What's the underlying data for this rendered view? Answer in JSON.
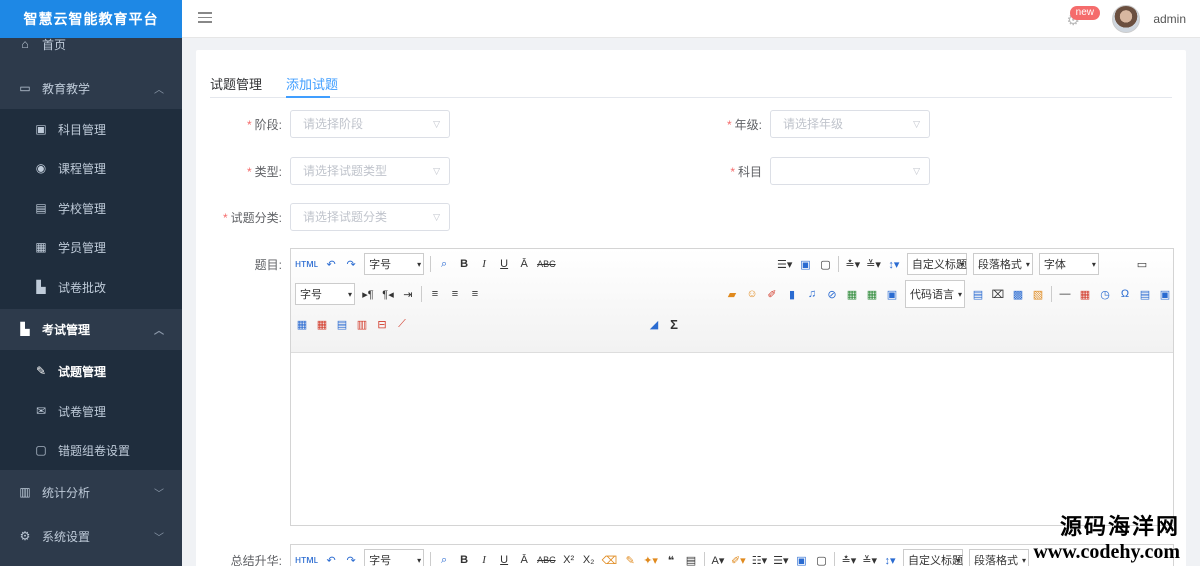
{
  "app": {
    "title": "智慧云智能教育平台"
  },
  "header": {
    "badge": "new",
    "user": "admin"
  },
  "sidebar": {
    "items": [
      {
        "label": "首页",
        "icon": "home-icon"
      },
      {
        "label": "教育教学",
        "icon": "video-icon"
      },
      {
        "label": "科目管理",
        "icon": "briefcase-icon"
      },
      {
        "label": "课程管理",
        "icon": "eye-icon"
      },
      {
        "label": "学校管理",
        "icon": "school-icon"
      },
      {
        "label": "学员管理",
        "icon": "student-icon"
      },
      {
        "label": "试卷批改",
        "icon": "car-icon"
      },
      {
        "label": "考试管理",
        "icon": "car-icon"
      },
      {
        "label": "试题管理",
        "icon": "edit-icon"
      },
      {
        "label": "试卷管理",
        "icon": "mail-icon"
      },
      {
        "label": "错题组卷设置",
        "icon": "doc-icon"
      },
      {
        "label": "统计分析",
        "icon": "chart-icon"
      },
      {
        "label": "系统设置",
        "icon": "gear-icon"
      }
    ]
  },
  "tabs": [
    "试题管理",
    "添加试题"
  ],
  "form": {
    "stage_label": "阶段:",
    "stage_placeholder": "请选择阶段",
    "grade_label": "年级:",
    "grade_placeholder": "请选择年级",
    "type_label": "类型:",
    "type_placeholder": "请选择试题类型",
    "subject_label": "科目",
    "category_label": "试题分类:",
    "category_placeholder": "请选择试题分类",
    "question_label": "题目:",
    "summary_label": "总结升华:"
  },
  "editor": {
    "font_size": "字号",
    "custom_title": "自定义标题",
    "paragraph": "段落格式",
    "font": "字体",
    "code_lang": "代码语言"
  },
  "watermark": {
    "line1": "源码海洋网",
    "line2": "www.codehy.com"
  }
}
